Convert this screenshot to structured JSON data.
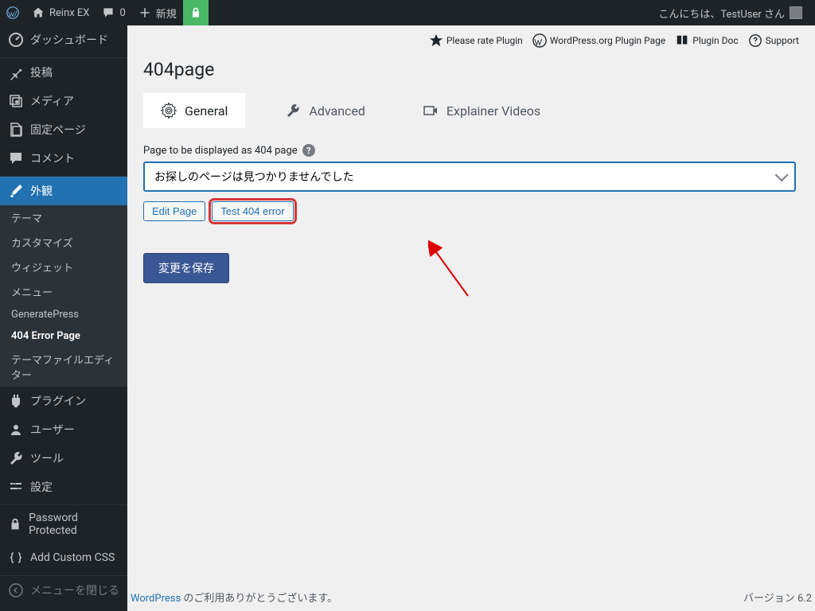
{
  "adminbar": {
    "site_name": "Reinx EX",
    "comments_count": "0",
    "new_label": "新規",
    "greeting": "こんにちは、TestUser さん"
  },
  "sidebar": {
    "dashboard": "ダッシュボード",
    "posts": "投稿",
    "media": "メディア",
    "pages": "固定ページ",
    "comments": "コメント",
    "appearance": "外観",
    "sub_themes": "テーマ",
    "sub_customize": "カスタマイズ",
    "sub_widgets": "ウィジェット",
    "sub_menus": "メニュー",
    "sub_generatepress": "GeneratePress",
    "sub_404": "404 Error Page",
    "sub_editor": "テーマファイルエディター",
    "plugins": "プラグイン",
    "users": "ユーザー",
    "tools": "ツール",
    "settings": "設定",
    "password_protected": "Password Protected",
    "custom_css": "Add Custom CSS",
    "collapse": "メニューを閉じる"
  },
  "toplinks": {
    "rate": "Please rate Plugin",
    "wporg": "WordPress.org Plugin Page",
    "doc": "Plugin Doc",
    "support": "Support"
  },
  "page": {
    "title": "404page",
    "tab_general": "General",
    "tab_advanced": "Advanced",
    "tab_videos": "Explainer Videos",
    "field_label": "Page to be displayed as 404 page",
    "select_value": "お探しのページは見つかりませんでした",
    "edit_page": "Edit Page",
    "test_404": "Test 404 error",
    "save_button": "変更を保存"
  },
  "footer": {
    "thanks_link": "WordPress",
    "thanks_text": " のご利用ありがとうございます。",
    "version": "バージョン 6.2"
  }
}
